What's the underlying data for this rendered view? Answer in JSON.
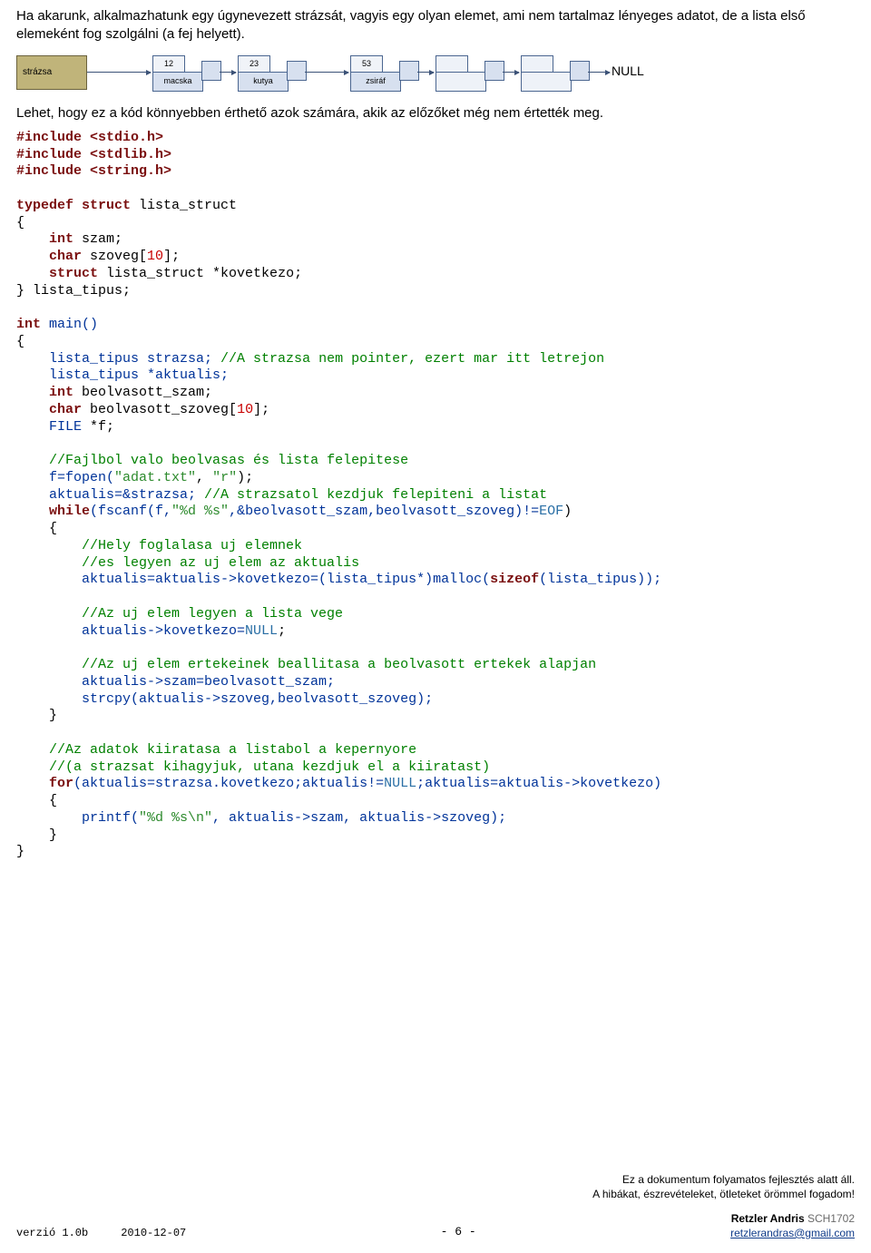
{
  "intro": {
    "para1": "Ha akarunk, alkalmazhatunk egy úgynevezett strázsát, vagyis egy olyan elemet, ami nem tartalmaz lényeges adatot, de a lista első elemeként fog szolgálni (a fej helyett).",
    "para2": "Lehet, hogy ez a kód könnyebben érthető azok számára, akik az előzőket még nem értették meg."
  },
  "diagram": {
    "strazsa": "strázsa",
    "node1_num": "12",
    "node1_label": "macska",
    "node2_num": "23",
    "node2_label": "kutya",
    "node3_num": "53",
    "node3_label": "zsiráf",
    "null_label": "NULL"
  },
  "code": {
    "inc1": "#include <stdio.h>",
    "inc2": "#include <stdlib.h>",
    "inc3": "#include <string.h>",
    "typedef": "typedef struct",
    "struct_name": " lista_struct",
    "open_brace": "{",
    "int_kw": "int",
    "szam": " szam;",
    "char_kw": "char",
    "szoveg": " szoveg[",
    "ten": "10",
    "szoveg_end": "];",
    "struct_kw": "struct",
    "ls_ptr": " lista_struct *kovetkezo;",
    "close_typedef": "} lista_tipus;",
    "int_main": "int",
    "main_fn": " main()",
    "m_open": "{",
    "lt": "lista_tipus strazsa;",
    "cmt1": " //A strazsa nem pointer, ezert mar itt letrejon",
    "lt_akt": "lista_tipus *aktualis;",
    "int_beolv": " beolvasott_szam;",
    "char_beolv": " beolvasott_szoveg[",
    "char_beolv_end": "];",
    "file_kw": "FILE",
    "file_var": " *f;",
    "cmt2": "//Fajlbol valo beolvasas és lista felepitese",
    "fopen_l": "f=fopen(",
    "fopen_s1": "\"adat.txt\"",
    "fopen_s2": "\"r\"",
    "fopen_r": ");",
    "akt_assign": "aktualis=&strazsa;",
    "cmt3": " //A strazsatol kezdjuk felepiteni a listat",
    "while_kw": "while",
    "while_l": "(fscanf(f,",
    "while_fmt": "\"%d %s\"",
    "while_r": ",&beolvasott_szam,beolvasott_szoveg)!=",
    "eof": "EOF",
    "while_end": ")",
    "cmt4": "//Hely foglalasa uj elemnek",
    "cmt5": "//es legyen az uj elem az aktualis",
    "malloc_line": "aktualis=aktualis->kovetkezo=(lista_tipus*)malloc(",
    "sizeof_kw": "sizeof",
    "malloc_end": "(lista_tipus));",
    "cmt6": "//Az uj elem legyen a lista vege",
    "akt_null": "aktualis->kovetkezo=",
    "null_kw": "NULL",
    "semi": ";",
    "cmt7": "//Az uj elem ertekeinek beallitasa a beolvasott ertekek alapjan",
    "akt_szam": "aktualis->szam=beolvasott_szam;",
    "strcpy_line": "strcpy(aktualis->szoveg,beolvasott_szoveg);",
    "close1": "}",
    "cmt8": "//Az adatok kiiratasa a listabol a kepernyore",
    "cmt9": "//(a strazsat kihagyjuk, utana kezdjuk el a kiiratast)",
    "for_kw": "for",
    "for_l": "(aktualis=strazsa.kovetkezo;aktualis!=",
    "for_r": ";aktualis=aktualis->kovetkezo)",
    "printf_l": "printf(",
    "printf_fmt": "\"%d %s\\n\"",
    "printf_r": ", aktualis->szam, aktualis->szoveg);",
    "close2": "}",
    "close3": "}"
  },
  "footer": {
    "note1": "Ez a dokumentum folyamatos fejlesztés alatt áll.",
    "note2": "A hibákat, észrevételeket, ötleteket örömmel fogadom!",
    "version": "verzió 1.0b",
    "date": "2010-12-07",
    "page": "- 6 -",
    "author": "Retzler Andris",
    "author_code": " SCH1702",
    "email": "retzlerandras@gmail.com"
  }
}
